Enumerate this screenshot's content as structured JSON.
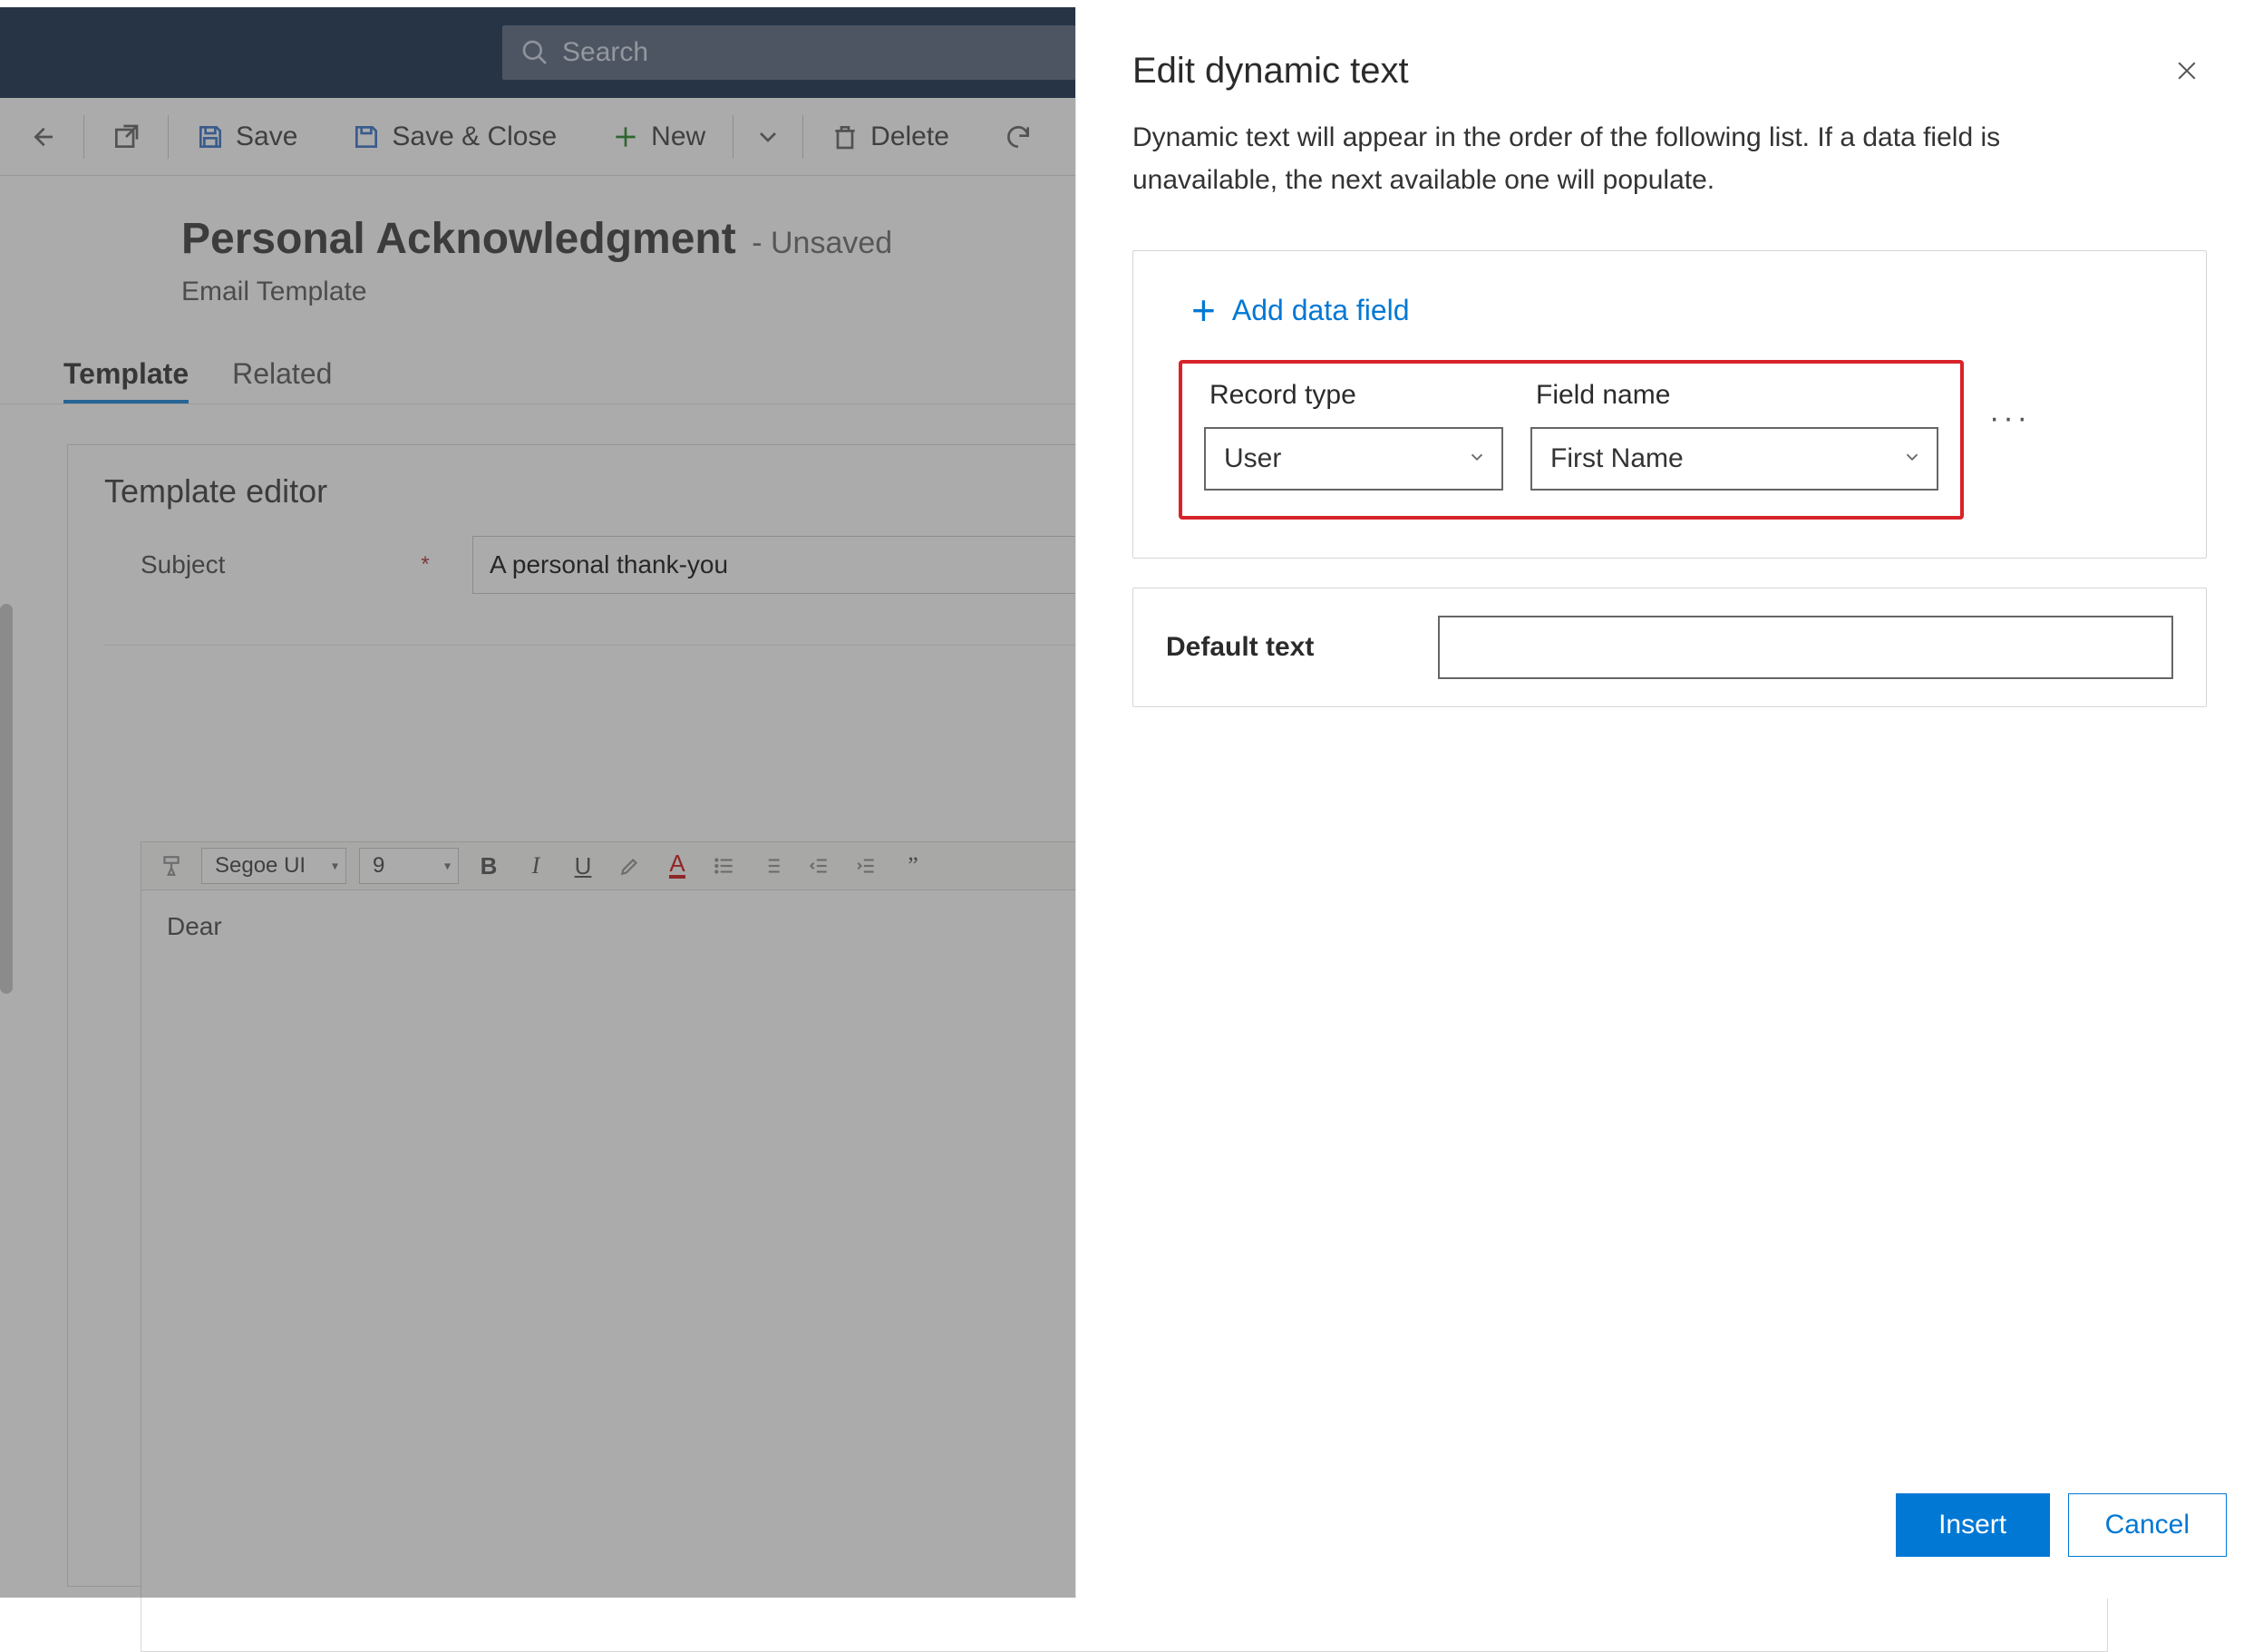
{
  "search": {
    "placeholder": "Search"
  },
  "commands": {
    "save": "Save",
    "saveClose": "Save & Close",
    "new_": "New",
    "delete_": "Delete"
  },
  "record": {
    "title": "Personal Acknowledgment",
    "suffix": "- Unsaved",
    "subtitle": "Email Template"
  },
  "tabs": {
    "template": "Template",
    "related": "Related"
  },
  "editor": {
    "section_title": "Template editor",
    "subject_label": "Subject",
    "subject_value": "A personal thank-you",
    "font_family": "Segoe UI",
    "font_size": "9",
    "body": "Dear"
  },
  "panel": {
    "title": "Edit dynamic text",
    "description": "Dynamic text will appear in the order of the following list. If a data field is unavailable, the next available one will populate.",
    "add_data_field": "Add data field",
    "col_record_type": "Record type",
    "col_field_name": "Field name",
    "row": {
      "record_type": "User",
      "field_name": "First Name"
    },
    "default_text_label": "Default text",
    "default_text_value": "",
    "insert": "Insert",
    "cancel": "Cancel"
  }
}
